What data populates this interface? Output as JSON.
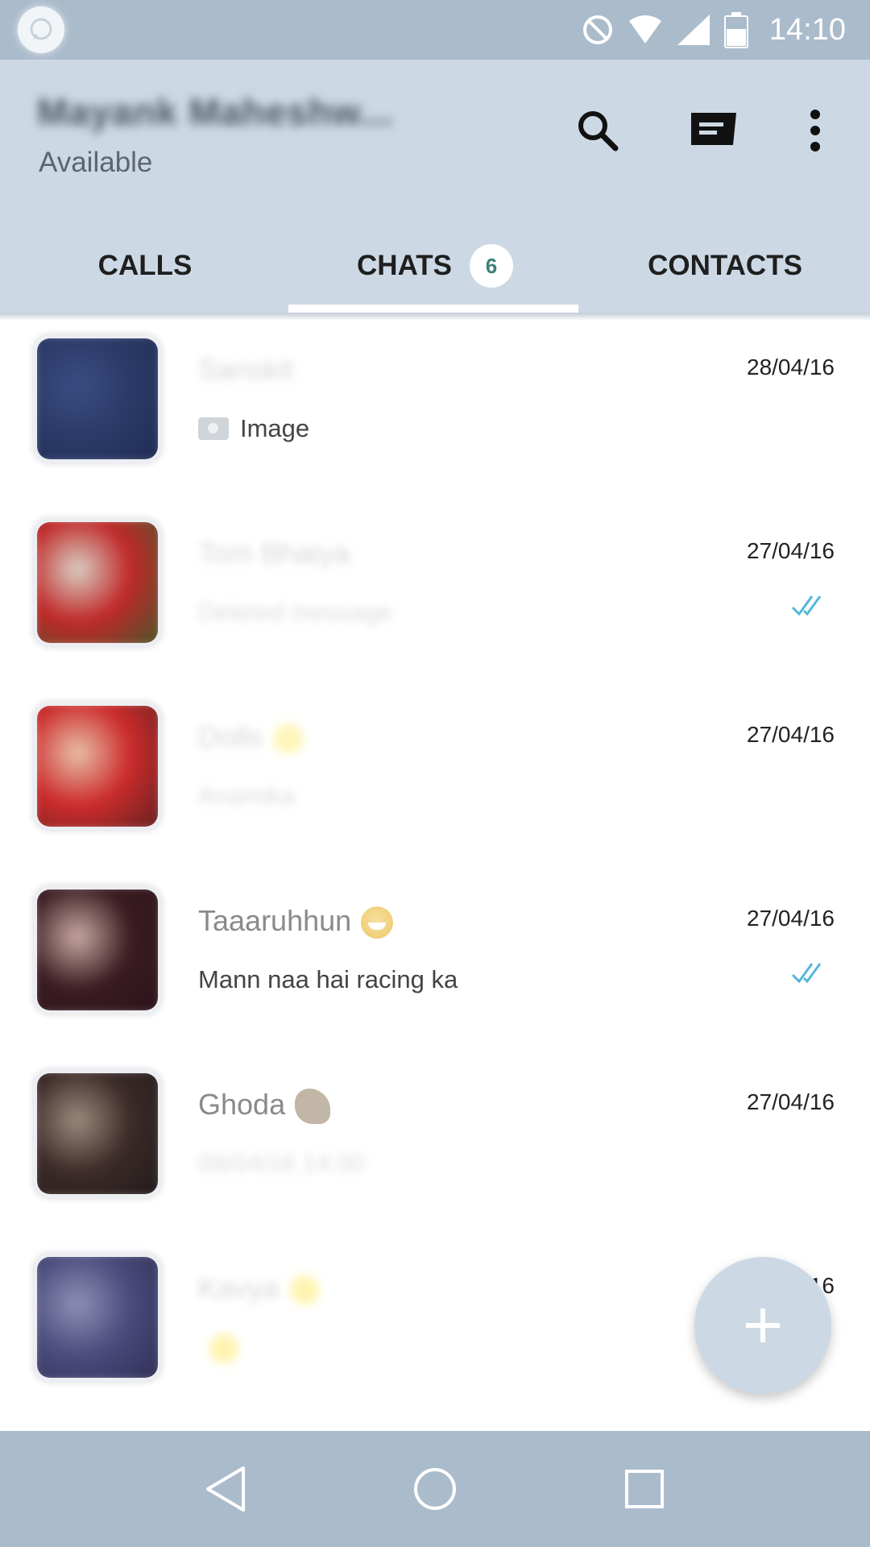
{
  "status_bar": {
    "time": "14:10",
    "icons": [
      "whatsapp-icon",
      "do-not-disturb-icon",
      "wifi-icon",
      "cell-signal-icon",
      "battery-icon"
    ]
  },
  "header": {
    "profile_name": "Mayank Maheshw...",
    "profile_status": "Available",
    "actions": [
      "search-icon",
      "new-chat-icon",
      "more-vert-icon"
    ]
  },
  "tabs": [
    {
      "label": "CALLS"
    },
    {
      "label": "CHATS",
      "badge": "6",
      "selected": true
    },
    {
      "label": "CONTACTS"
    }
  ],
  "chats": [
    {
      "name": "Sanskit",
      "message": "Image",
      "date": "28/04/16",
      "name_blurred": true,
      "message_blurred": false,
      "avatar_colors": [
        "#2b3a68",
        "#1d2a52",
        "#3a4c82"
      ],
      "read_ticks": false
    },
    {
      "name": "Tom Bhaiya",
      "message": "Deleted message",
      "date": "27/04/16",
      "name_blurred": true,
      "message_blurred": true,
      "avatar_colors": [
        "#c02828",
        "#3e5a2a",
        "#d9d0c4"
      ],
      "read_ticks": true
    },
    {
      "name": "Dolls",
      "message": "Anamika",
      "date": "27/04/16",
      "name_blurred": true,
      "message_blurred": true,
      "avatar_colors": [
        "#cc2b2b",
        "#5a2020",
        "#e8c0a8"
      ],
      "read_ticks": false
    },
    {
      "name": "Taaaruhhun",
      "message": "Mann naa hai racing ka",
      "date": "27/04/16",
      "name_blurred": false,
      "message_blurred": false,
      "avatar_colors": [
        "#3a1c22",
        "#2a1218",
        "#c9a9a3"
      ],
      "read_ticks": true
    },
    {
      "name": "Ghoda",
      "message": "09/04/16 14:00",
      "date": "27/04/16",
      "name_blurred": false,
      "message_blurred": true,
      "avatar_colors": [
        "#3b2a28",
        "#1f1a1a",
        "#9c8a7c"
      ],
      "read_ticks": false
    },
    {
      "name": "Kavya",
      "message": "",
      "date": "27/04/16",
      "name_blurred": true,
      "message_blurred": true,
      "avatar_colors": [
        "#4a4a7c",
        "#2d2d52",
        "#8f8fb5"
      ],
      "read_ticks": false
    }
  ],
  "fab": {
    "icon": "plus-icon"
  },
  "nav": [
    "back-icon",
    "home-icon",
    "recents-icon"
  ],
  "colors": {
    "status_bar": "#aabbcb",
    "app_bar": "#ccd9e5",
    "tab_badge_text": "#3c7f77",
    "read_ticks": "#53b7d9"
  }
}
